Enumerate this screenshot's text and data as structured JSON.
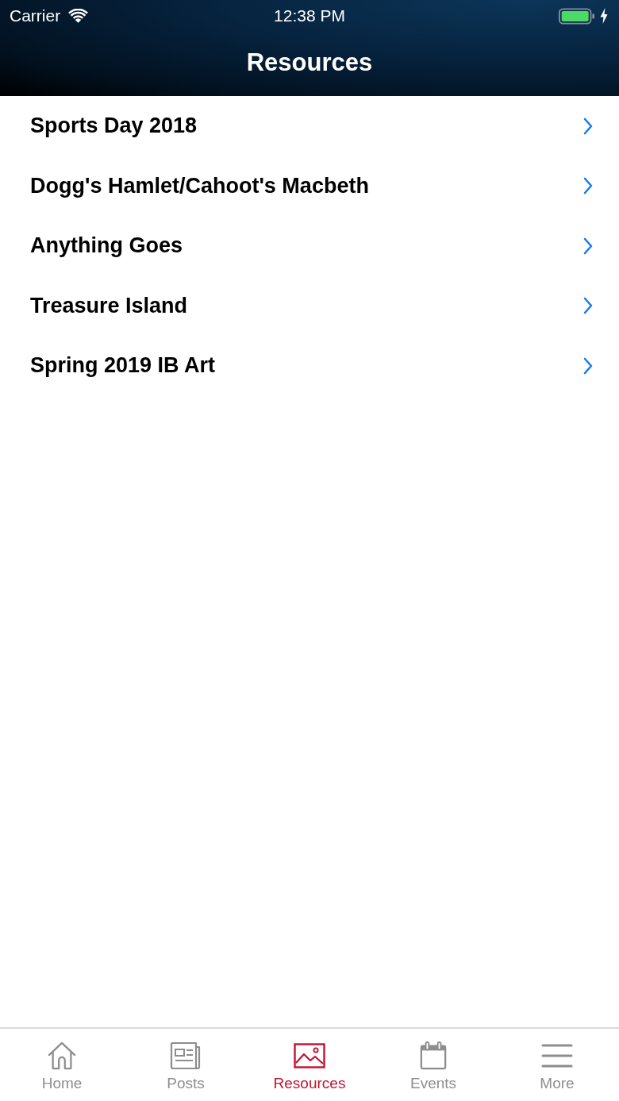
{
  "status_bar": {
    "carrier": "Carrier",
    "time": "12:38 PM",
    "charging": true
  },
  "nav_bar": {
    "title": "Resources"
  },
  "list": {
    "items": [
      {
        "label": "Sports Day 2018"
      },
      {
        "label": "Dogg's Hamlet/Cahoot's Macbeth"
      },
      {
        "label": "Anything Goes"
      },
      {
        "label": "Treasure Island"
      },
      {
        "label": "Spring 2019 IB Art"
      }
    ]
  },
  "tab_bar": {
    "tabs": [
      {
        "kind": "home",
        "label": "Home",
        "selected": false
      },
      {
        "kind": "posts",
        "label": "Posts",
        "selected": false
      },
      {
        "kind": "resources",
        "label": "Resources",
        "selected": true
      },
      {
        "kind": "events",
        "label": "Events",
        "selected": false
      },
      {
        "kind": "more",
        "label": "More",
        "selected": false
      }
    ]
  }
}
